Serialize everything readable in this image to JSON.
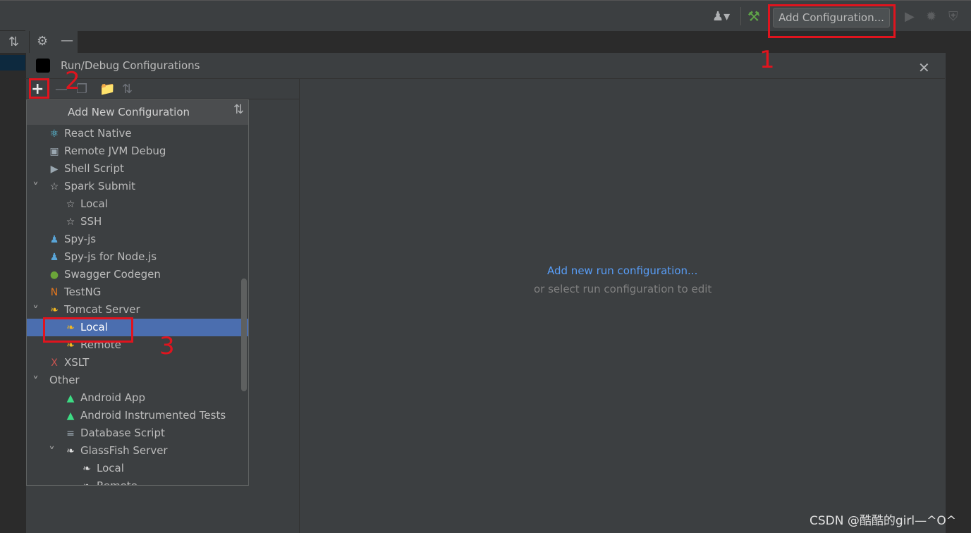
{
  "toolbar": {
    "add_configuration_label": "Add Configuration...",
    "icons": [
      "user-icon",
      "build-hammer-icon",
      "run-icon",
      "debug-icon",
      "coverage-icon"
    ]
  },
  "dialog": {
    "title": "Run/Debug Configurations",
    "popup_title": "Add New Configuration",
    "items": [
      {
        "label": "React Native",
        "icon": "react-icon",
        "icon_color": "#61dafb"
      },
      {
        "label": "Remote JVM Debug",
        "icon": "remote-debug-icon",
        "icon_color": "#9aa7b0"
      },
      {
        "label": "Shell Script",
        "icon": "shell-script-icon",
        "icon_color": "#9aa7b0"
      },
      {
        "label": "Spark Submit",
        "icon": "spark-icon",
        "icon_color": "#bbbbbb",
        "expanded": true
      },
      {
        "label": "Local",
        "icon": "spark-icon",
        "icon_color": "#bbbbbb"
      },
      {
        "label": "SSH",
        "icon": "spark-icon",
        "icon_color": "#bbbbbb"
      },
      {
        "label": "Spy-js",
        "icon": "spy-js-icon",
        "icon_color": "#59a5d8"
      },
      {
        "label": "Spy-js for Node.js",
        "icon": "spy-js-node-icon",
        "icon_color": "#59a5d8"
      },
      {
        "label": "Swagger Codegen",
        "icon": "swagger-icon",
        "icon_color": "#6ba539"
      },
      {
        "label": "TestNG",
        "icon": "testng-icon",
        "icon_color": "#e5771e"
      },
      {
        "label": "Tomcat Server",
        "icon": "tomcat-icon",
        "icon_color": "#f4b920",
        "expanded": true
      },
      {
        "label": "Local",
        "icon": "tomcat-icon",
        "icon_color": "#f4b920",
        "selected": true
      },
      {
        "label": "Remote",
        "icon": "tomcat-icon",
        "icon_color": "#f4b920"
      },
      {
        "label": "XSLT",
        "icon": "xslt-icon",
        "icon_color": "#c75450"
      },
      {
        "label": "Other",
        "expanded": true
      },
      {
        "label": "Android App",
        "icon": "android-icon",
        "icon_color": "#3ddc84"
      },
      {
        "label": "Android Instrumented Tests",
        "icon": "android-test-icon",
        "icon_color": "#3ddc84"
      },
      {
        "label": "Database Script",
        "icon": "database-icon",
        "icon_color": "#9aa7b0"
      },
      {
        "label": "GlassFish Server",
        "icon": "glassfish-icon",
        "icon_color": "#dddddd",
        "expanded": true
      },
      {
        "label": "Local",
        "icon": "glassfish-icon",
        "icon_color": "#dddddd"
      },
      {
        "label": "Remote",
        "icon": "glassfish-icon",
        "icon_color": "#dddddd"
      }
    ],
    "empty_state": {
      "link": "Add new run configuration...",
      "hint": "or select run configuration to edit"
    }
  },
  "annotations": [
    "1",
    "2",
    "3"
  ],
  "watermark": "CSDN @酷酷的girl—^O^"
}
